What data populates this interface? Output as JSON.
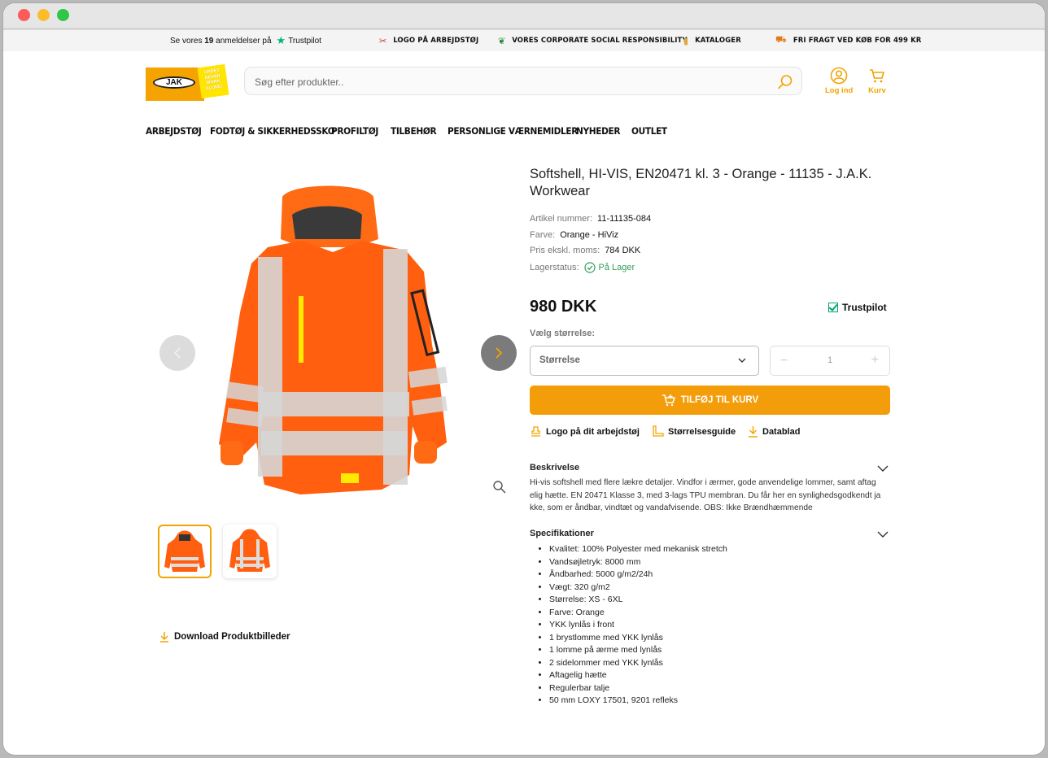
{
  "topbar": {
    "trustpilot_prefix": "Se vores",
    "trustpilot_count": "19",
    "trustpilot_mid": "anmeldelser på",
    "trustpilot_brand": "Trustpilot",
    "links": [
      {
        "label": "LOGO PÅ ARBEJDSTØJ",
        "icon": "scissors-icon"
      },
      {
        "label": "VORES CORPORATE SOCIAL RESPONSIBILITY",
        "icon": "leaf-icon"
      },
      {
        "label": "KATALOGER",
        "icon": "catalog-icon"
      },
      {
        "label": "FRI FRAGT VED KØB FOR 499 KR",
        "icon": "truck-icon"
      }
    ]
  },
  "logo": {
    "text": "JAK",
    "badge": "ORDET NEVER WORK ALONE!"
  },
  "search": {
    "placeholder": "Søg efter produkter.."
  },
  "header": {
    "login_label": "Log ind",
    "cart_label": "Kurv"
  },
  "nav": [
    "ARBEJDSTØJ",
    "FODTØJ & SIKKERHEDSSKO",
    "PROFILTØJ",
    "TILBEHØR",
    "PERSONLIGE VÆRNEMIDLER",
    "NYHEDER",
    "OUTLET"
  ],
  "product": {
    "title": "Softshell, HI-VIS, EN20471 kl. 3 - Orange - 11135 - J.A.K. Workwear",
    "meta": [
      {
        "label": "Artikel nummer:",
        "value": "11-11135-084"
      },
      {
        "label": "Farve:",
        "value": "Orange - HiViz"
      },
      {
        "label": "Pris ekskl. moms:",
        "value": "784 DKK"
      },
      {
        "label": "Lagerstatus:",
        "value": "På Lager"
      }
    ],
    "price": "980 DKK",
    "trustpilot": "Trustpilot",
    "size_label": "Vælg størrelse:",
    "size_select": "Størrelse",
    "qty": "1",
    "add_to_cart": "TILFØJ TIL KURV",
    "links": [
      "Logo på dit arbejdstøj",
      "Størrelsesguide",
      "Datablad"
    ],
    "description_title": "Beskrivelse",
    "description_lines": [
      "Hi-vis softshell med flere lækre detaljer. Vindfor i ærmer, gode anvendelige lommer, samt aftag",
      "elig hætte. EN 20471 Klasse 3, med 3-lags TPU membran. Du får her en synlighedsgodkendt ja",
      "kke, som er åndbar, vindtæt og vandafvisende. OBS: Ikke Brændhæmmende"
    ],
    "specs_title": "Specifikationer",
    "specs": [
      "Kvalitet: 100% Polyester med mekanisk stretch",
      "Vandsøjletryk: 8000 mm",
      "Åndbarhed: 5000 g/m2/24h",
      "Vægt: 320 g/m2",
      "Størrelse: XS - 6XL",
      "Farve: Orange",
      "YKK lynlås i front",
      "1 brystlomme med YKK lynlås",
      "1 lomme på ærme med lynlås",
      "2 sidelommer med YKK lynlås",
      "Aftagelig hætte",
      "Regulerbar talje",
      "50 mm LOXY 17501, 9201 refleks"
    ],
    "download_images": "Download Produktbilleder"
  },
  "colors": {
    "accent": "#f49d0a",
    "stock_ok": "#2f9e58",
    "trustpilot_green": "#00b67a"
  }
}
